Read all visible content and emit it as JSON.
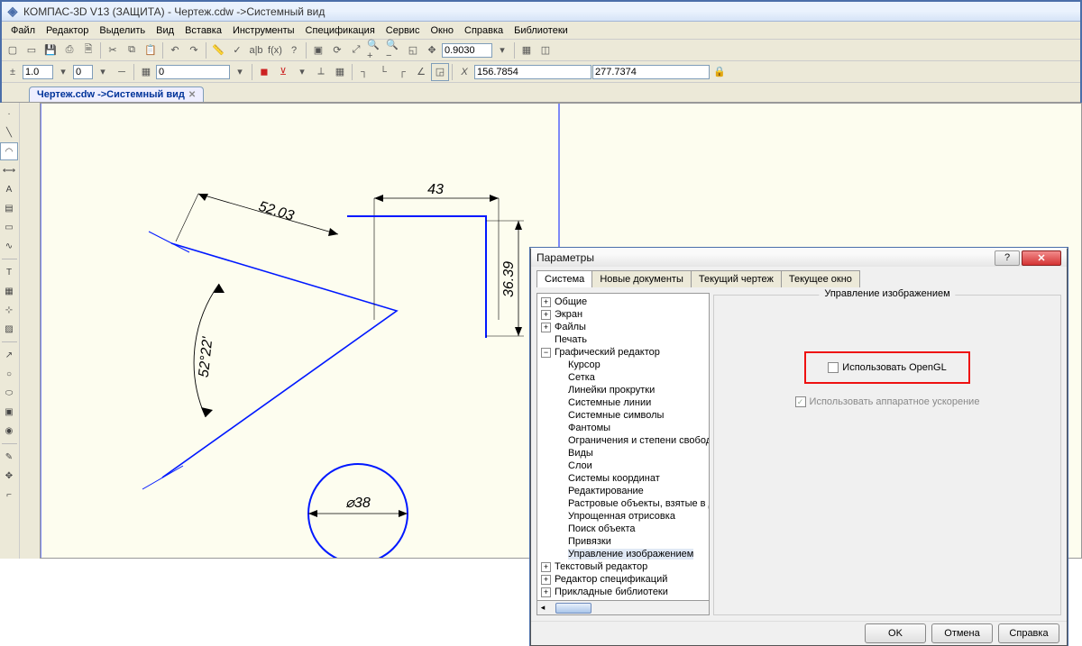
{
  "title": "КОМПАС-3D V13 (ЗАЩИТА) - Чертеж.cdw ->Системный вид",
  "menus": [
    "Файл",
    "Редактор",
    "Выделить",
    "Вид",
    "Вставка",
    "Инструменты",
    "Спецификация",
    "Сервис",
    "Окно",
    "Справка",
    "Библиотеки"
  ],
  "toolbar1": {
    "zoom_val": "0.9030"
  },
  "toolbar2": {
    "val1": "1.0",
    "val2": "0",
    "val3": "0",
    "cx": "156.7854",
    "cy": "277.7374"
  },
  "doc_tab": "Чертеж.cdw ->Системный вид",
  "drawing": {
    "dim1": "52.03",
    "dim2": "43",
    "dim3": "36.39",
    "angle": "52°22'",
    "dia": "⌀38"
  },
  "dialog": {
    "title": "Параметры",
    "tabs": [
      "Система",
      "Новые документы",
      "Текущий чертеж",
      "Текущее окно"
    ],
    "tree": [
      {
        "l": "Общие",
        "tw": "+",
        "i": 0
      },
      {
        "l": "Экран",
        "tw": "+",
        "i": 0
      },
      {
        "l": "Файлы",
        "tw": "+",
        "i": 0
      },
      {
        "l": "Печать",
        "tw": "",
        "i": 0
      },
      {
        "l": "Графический редактор",
        "tw": "−",
        "i": 0
      },
      {
        "l": "Курсор",
        "tw": "",
        "i": 2
      },
      {
        "l": "Сетка",
        "tw": "",
        "i": 2
      },
      {
        "l": "Линейки прокрутки",
        "tw": "",
        "i": 2
      },
      {
        "l": "Системные линии",
        "tw": "",
        "i": 2
      },
      {
        "l": "Системные символы",
        "tw": "",
        "i": 2
      },
      {
        "l": "Фантомы",
        "tw": "",
        "i": 2
      },
      {
        "l": "Ограничения и степени свободы",
        "tw": "",
        "i": 2
      },
      {
        "l": "Виды",
        "tw": "",
        "i": 2
      },
      {
        "l": "Слои",
        "tw": "",
        "i": 2
      },
      {
        "l": "Системы координат",
        "tw": "",
        "i": 2
      },
      {
        "l": "Редактирование",
        "tw": "",
        "i": 2
      },
      {
        "l": "Растровые объекты, взятые в документ",
        "tw": "",
        "i": 2
      },
      {
        "l": "Упрощенная отрисовка",
        "tw": "",
        "i": 2
      },
      {
        "l": "Поиск объекта",
        "tw": "",
        "i": 2
      },
      {
        "l": "Привязки",
        "tw": "",
        "i": 2
      },
      {
        "l": "Управление изображением",
        "tw": "",
        "i": 2,
        "sel": true
      },
      {
        "l": "Текстовый редактор",
        "tw": "+",
        "i": 0
      },
      {
        "l": "Редактор спецификаций",
        "tw": "+",
        "i": 0
      },
      {
        "l": "Прикладные библиотеки",
        "tw": "+",
        "i": 0
      }
    ],
    "group_title": "Управление изображением",
    "cb1": "Использовать OpenGL",
    "cb2": "Использовать аппаратное ускорение",
    "buttons": {
      "ok": "OK",
      "cancel": "Отмена",
      "help": "Справка"
    }
  }
}
